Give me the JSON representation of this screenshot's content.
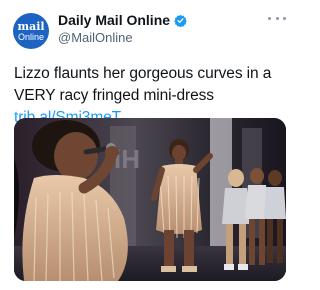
{
  "account": {
    "avatar_line1": "mail",
    "avatar_line2": "Online",
    "display_name": "Daily Mail Online",
    "handle": "@MailOnline",
    "verified_icon": "verified-badge-icon"
  },
  "tweet": {
    "text": "Lizzo flaunts her gorgeous curves in a VERY racy fringed mini-dress ",
    "link": "trib.al/Smi3meT",
    "media_description_icon": "photo"
  },
  "colors": {
    "accent": "#1d9bf0",
    "avatar_bg": "#1e63c2"
  }
}
